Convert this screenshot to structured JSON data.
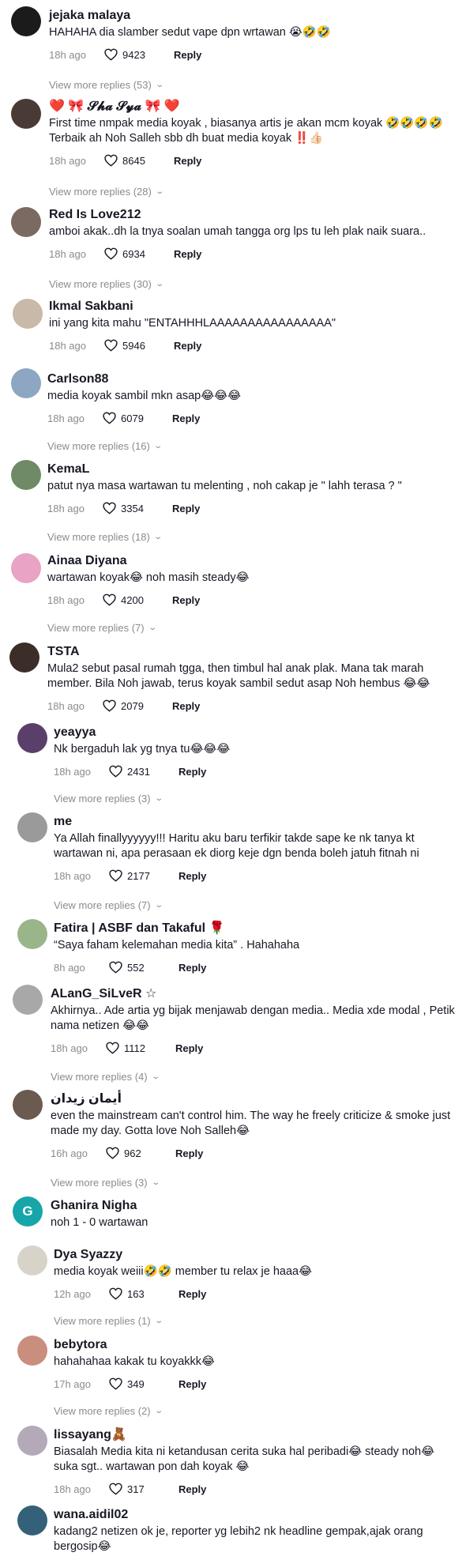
{
  "view_more_chevron": "⌄",
  "comments": [
    {
      "username": "jejaka malaya",
      "text": "HAHAHA dia slamber sedut vape dpn wrtawan 😭🤣🤣",
      "time": "18h ago",
      "likes": "9423",
      "reply": "Reply",
      "more": "View more replies (53)",
      "avatar_color": "#1b1b1b"
    },
    {
      "username": "❤️ 🎀 𝓢𝓱𝓪 𝓢𝔂𝓪 🎀 ❤️",
      "text": "First time nmpak media koyak , biasanya artis je akan mcm koyak 🤣🤣🤣🤣 Terbaik ah Noh Salleh sbb dh buat media koyak ‼️👍🏻",
      "time": "18h ago",
      "likes": "8645",
      "reply": "Reply",
      "more": "View more replies (28)",
      "avatar_color": "#4a3a36"
    },
    {
      "username": "Red Is Love212",
      "text": "amboi akak..dh la tnya soalan umah tangga org lps tu leh plak naik suara..",
      "time": "18h ago",
      "likes": "6934",
      "reply": "Reply",
      "more": "View more replies (30)",
      "avatar_color": "#7b6a62"
    },
    {
      "username": "Ikmal Sakbani",
      "text": "ini yang kita mahu \"ENTAHHHLAAAAAAAAAAAAAAAA\"",
      "time": "18h ago",
      "likes": "5946",
      "reply": "Reply",
      "more": "",
      "avatar_color": "#c9b9a8"
    },
    {
      "username": "Carlson88",
      "text": "media koyak sambil mkn asap😂😂😂",
      "time": "18h ago",
      "likes": "6079",
      "reply": "Reply",
      "more": "View more replies (16)",
      "avatar_color": "#8da6c2"
    },
    {
      "username": "KemaL",
      "text": "patut nya masa wartawan tu melenting , noh cakap je \" lahh terasa ? \"",
      "time": "18h ago",
      "likes": "3354",
      "reply": "Reply",
      "more": "View more replies (18)",
      "avatar_color": "#6f8a66"
    },
    {
      "username": "Ainaa Diyana",
      "text": "wartawan koyak😂 noh masih steady😂",
      "time": "18h ago",
      "likes": "4200",
      "reply": "Reply",
      "more": "View more replies (7)",
      "avatar_color": "#e9a3c4"
    },
    {
      "username": "TSTA",
      "text": "Mula2 sebut pasal rumah tgga, then timbul hal anak plak. Mana tak marah member. Bila Noh jawab, terus koyak sambil sedut asap Noh hembus 😂😂",
      "time": "18h ago",
      "likes": "2079",
      "reply": "Reply",
      "more": "",
      "avatar_color": "#3b2d28"
    },
    {
      "username": "yeayya",
      "text": "Nk bergaduh lak yg tnya tu😂😂😂",
      "time": "18h ago",
      "likes": "2431",
      "reply": "Reply",
      "more": "View more replies (3)",
      "avatar_color": "#5b3f6b"
    },
    {
      "username": "me",
      "text": "Ya Allah finallyyyyyy!!! Haritu aku baru terfikir takde sape ke nk tanya kt wartawan ni, apa perasaan ek diorg keje dgn benda boleh jatuh fitnah ni",
      "time": "18h ago",
      "likes": "2177",
      "reply": "Reply",
      "more": "View more replies (7)",
      "avatar_color": "#9a9a9a"
    },
    {
      "username": "Fatira | ASBF dan Takaful 🌹",
      "text": "“Saya faham kelemahan media kita” . Hahahaha",
      "time": "8h ago",
      "likes": "552",
      "reply": "Reply",
      "more": "",
      "avatar_color": "#9bb58a"
    },
    {
      "username": "ALanG_SiLveR ☆",
      "text": "Akhirnya.. Ade artia yg bijak menjawab dengan media.. Media xde modal , Petik nama netizen 😂😂",
      "time": "18h ago",
      "likes": "1112",
      "reply": "Reply",
      "more": "View more replies (4)",
      "avatar_color": "#a8a8a8"
    },
    {
      "username": "أيمان زيدان",
      "text": "even the mainstream can't control him. The way he freely criticize & smoke just made my day. Gotta love Noh Salleh😂",
      "time": "16h ago",
      "likes": "962",
      "reply": "Reply",
      "more": "View more replies (3)",
      "avatar_color": "#6b5a4f"
    },
    {
      "username": "Ghanira Nigha",
      "text": "noh 1 - 0 wartawan",
      "time": "",
      "likes": "",
      "reply": "",
      "more": "",
      "avatar_color": "#16a6a9",
      "avatar_letter": "G"
    },
    {
      "username": "Dya Syazzy",
      "text": "media koyak weiii🤣🤣 member tu relax je haaa😂",
      "time": "12h ago",
      "likes": "163",
      "reply": "Reply",
      "more": "View more replies (1)",
      "avatar_color": "#d8d3c9"
    },
    {
      "username": "bebytora",
      "text": "hahahahaa kakak tu koyakkk😂",
      "time": "17h ago",
      "likes": "349",
      "reply": "Reply",
      "more": "View more replies (2)",
      "avatar_color": "#c98e7e"
    },
    {
      "username": "lissayang🧸",
      "text": "Biasalah Media kita ni ketandusan cerita suka hal peribadi😂 steady noh😂 suka sgt.. wartawan pon dah koyak 😂",
      "time": "18h ago",
      "likes": "317",
      "reply": "Reply",
      "more": "",
      "avatar_color": "#b3a9b8"
    },
    {
      "username": "wana.aidil02",
      "text": "kadang2 netizen ok je, reporter yg lebih2 nk headline gempak,ajak orang bergosip😂",
      "time": "",
      "likes": "",
      "reply": "",
      "more": "",
      "avatar_color": "#35607a"
    }
  ]
}
